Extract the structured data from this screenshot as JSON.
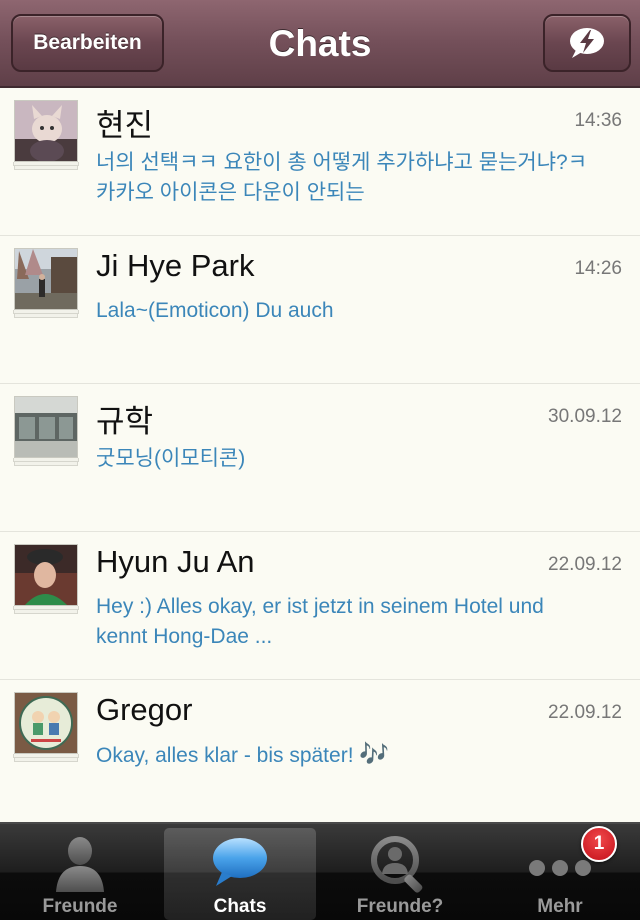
{
  "colors": {
    "navbar": "#74505a",
    "message_text": "#3b86b9",
    "time_text": "#777777",
    "badge": "#d8202a"
  },
  "navbar": {
    "title": "Chats",
    "edit_label": "Bearbeiten",
    "compose_icon": "speech-bubble-lightning-icon"
  },
  "chats": [
    {
      "name": "현진",
      "time": "14:36",
      "message": "너의 선택ㅋㅋ 요한이 총 어떻게 추가하냐고 묻는거냐?ㅋ 카카오 아이콘은 다운이 안되는",
      "avatar_icon": "cat-photo-avatar"
    },
    {
      "name": "Ji Hye Park",
      "time": "14:26",
      "message": "Lala~(Emoticon) Du auch",
      "avatar_icon": "street-photo-avatar"
    },
    {
      "name": "규학",
      "time": "30.09.12",
      "message": "굿모닝(이모티콘)",
      "avatar_icon": "building-photo-avatar"
    },
    {
      "name": "Hyun Ju An",
      "time": "22.09.12",
      "message": "Hey :) Alles okay, er ist jetzt in seinem Hotel und kennt Hong-Dae ...",
      "avatar_icon": "portrait-photo-avatar"
    },
    {
      "name": "Gregor",
      "time": "22.09.12",
      "message": "Okay, alles klar - bis später! ",
      "message_emoji": "🎶",
      "avatar_icon": "sticker-photo-avatar"
    }
  ],
  "tabbar": {
    "tabs": [
      {
        "label": "Freunde",
        "icon": "person-icon"
      },
      {
        "label": "Chats",
        "icon": "chat-bubble-icon",
        "active": true
      },
      {
        "label": "Freunde?",
        "icon": "search-person-icon"
      },
      {
        "label": "Mehr",
        "icon": "more-dots-icon"
      }
    ],
    "badge_count": "1"
  }
}
